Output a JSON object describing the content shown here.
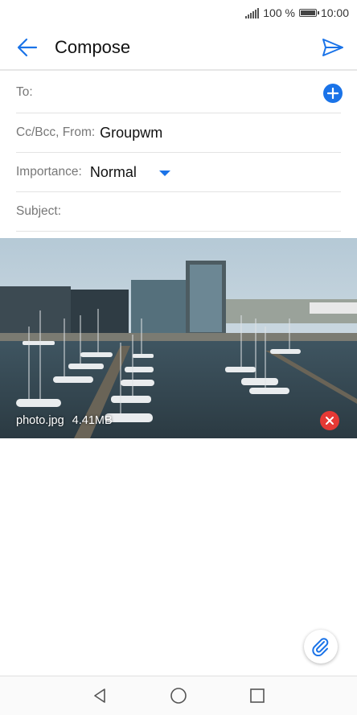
{
  "status_bar": {
    "battery_text": "100 %",
    "time": "10:00",
    "battery_level": 1.0
  },
  "app_bar": {
    "title": "Compose",
    "back_icon": "arrow-back-icon",
    "send_icon": "send-icon"
  },
  "form": {
    "to_label": "To:",
    "cc_label": "Cc/Bcc, From:",
    "from_value": "Groupwm",
    "importance_label": "Importance:",
    "importance_value": "Normal",
    "subject_label": "Subject:"
  },
  "attachment": {
    "filename": "photo.jpg",
    "size": "4.41MB"
  },
  "colors": {
    "accent": "#1a73e8",
    "remove": "#e53935"
  }
}
